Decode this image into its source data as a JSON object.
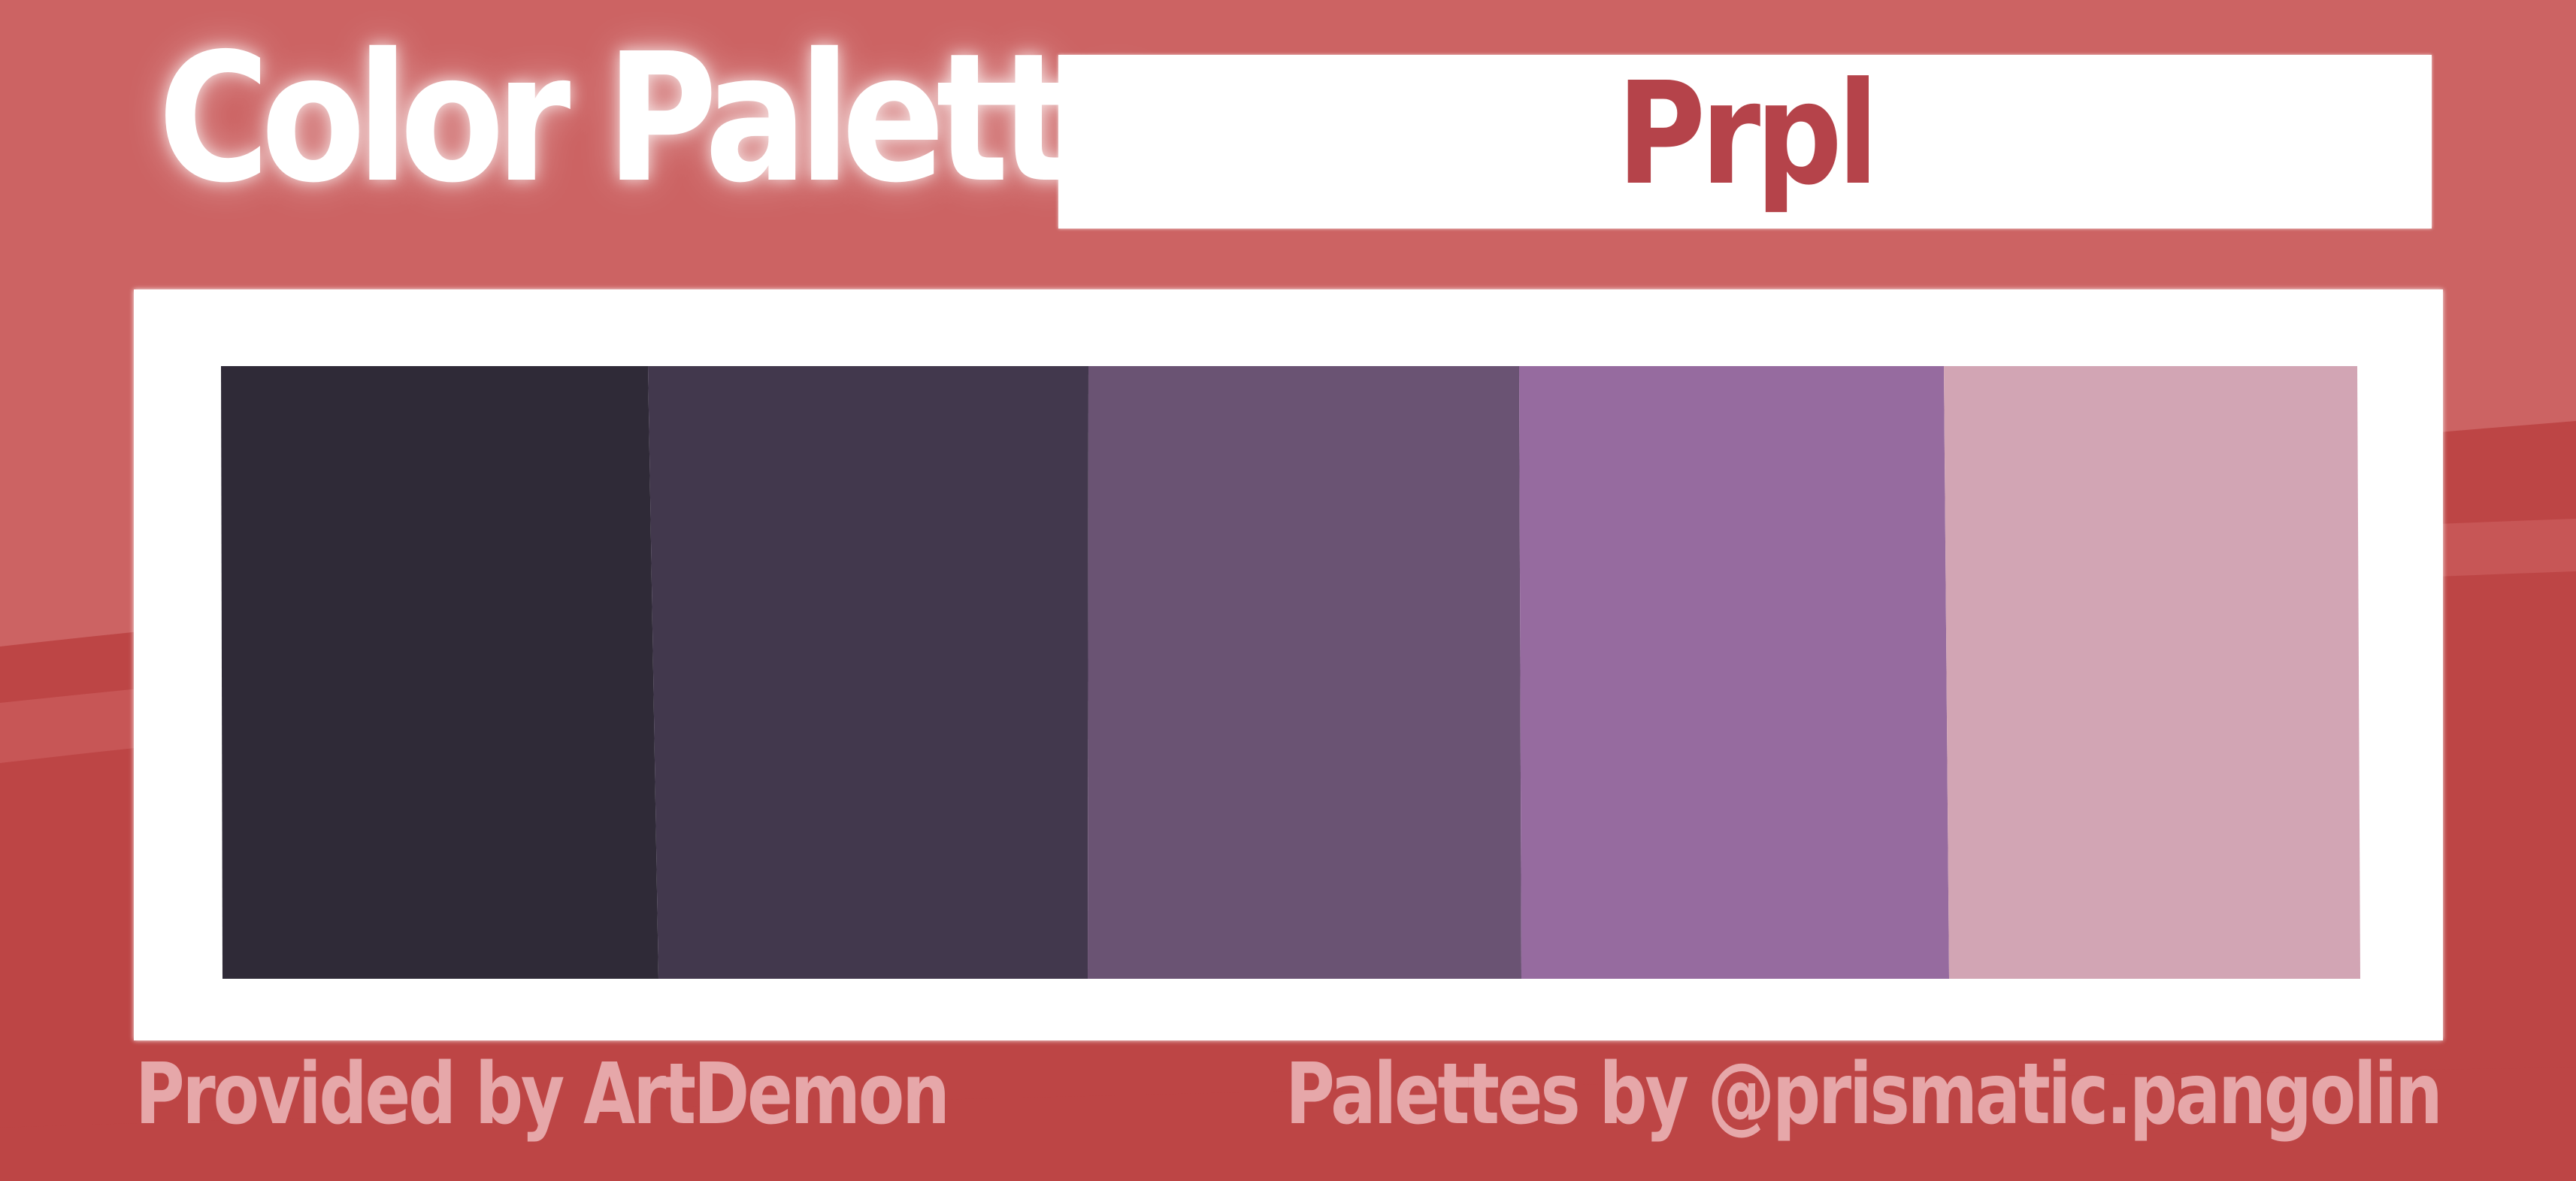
{
  "title": "Color Palette",
  "palette_name": "Prpl",
  "swatches": [
    {
      "name": "swatch-1",
      "color": "#2f2a37"
    },
    {
      "name": "swatch-2",
      "color": "#42384d"
    },
    {
      "name": "swatch-3",
      "color": "#6a5373"
    },
    {
      "name": "swatch-4",
      "color": "#966b9f"
    },
    {
      "name": "swatch-5",
      "color": "#d2a5b4"
    }
  ],
  "footer": {
    "provided_by": "Provided by ArtDemon",
    "palettes_by": "Palettes by @prismatic.pangolin"
  },
  "colors": {
    "background": "#cc6363",
    "background_dark": "#bd4545",
    "stripe": "#c75656",
    "frame": "#ffffff",
    "title": "#ffffff",
    "palette_name": "#b5434a",
    "footer_text": "#e6a7a9"
  }
}
